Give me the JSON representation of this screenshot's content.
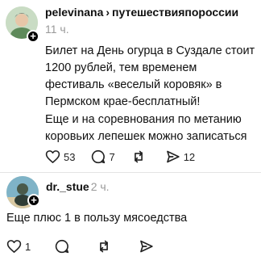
{
  "post": {
    "username": "pelevinana",
    "separator": "›",
    "topic": "путешествияпороссии",
    "time": "11 ч.",
    "paragraph1": "Билет на День огурца в Суздале стоит 1200 рублей, тем временем фестиваль «веселый коровяк» в Пермском крае-бесплатный!",
    "paragraph2": "Еще и на соревнования по метанию коровьих лепешек можно записаться",
    "likes": "53",
    "comments": "7",
    "reposts": "",
    "shares": "12"
  },
  "reply": {
    "username": "dr._stue",
    "time": "2 ч.",
    "text": "Еще плюс 1 в пользу мясоедства",
    "likes": "1"
  },
  "icons": {
    "like": "heart-outline-icon",
    "comment": "speech-bubble-icon",
    "repost": "repost-arrows-icon",
    "share": "paper-plane-icon",
    "follow": "plus-badge-icon"
  }
}
